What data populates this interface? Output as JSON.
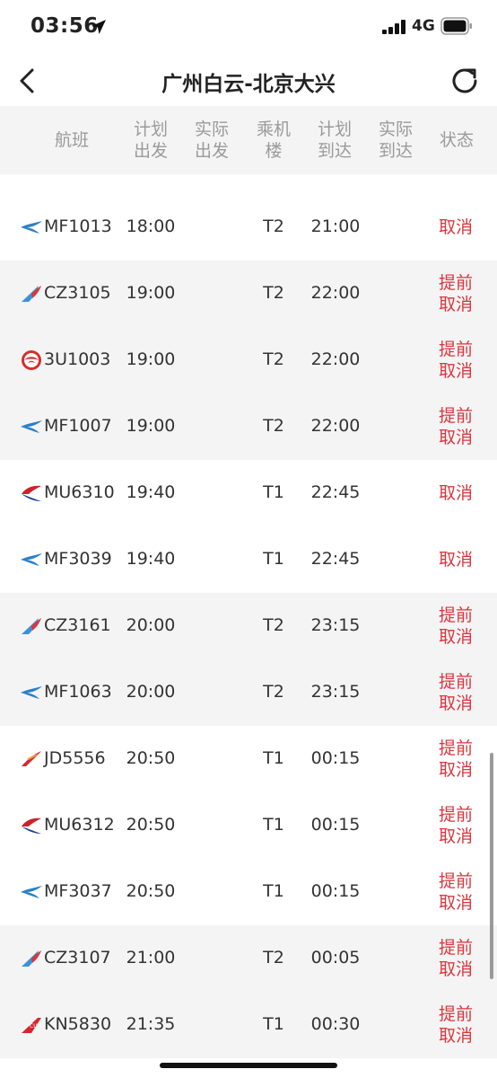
{
  "status_bar": {
    "time": "03:56",
    "network": "4G"
  },
  "nav": {
    "title": "广州白云-北京大兴"
  },
  "columns": {
    "flight": "航班",
    "planned_dep": [
      "计划",
      "出发"
    ],
    "actual_dep": [
      "实际",
      "出发"
    ],
    "terminal": [
      "乘机",
      "楼"
    ],
    "planned_arr": [
      "计划",
      "到达"
    ],
    "actual_arr": [
      "实际",
      "到达"
    ],
    "status": "状态"
  },
  "colors": {
    "status_red": "#d9363e",
    "header_gray": "#9a9a9a",
    "stripe_gray": "#f4f4f4"
  },
  "flights": [
    {
      "logo": "xiamen-airlines-logo",
      "flight": "MF1013",
      "dep": "18:00",
      "terminal": "T2",
      "arr": "21:00",
      "status": [
        "取消"
      ]
    },
    {
      "logo": "china-southern-logo",
      "flight": "CZ3105",
      "dep": "19:00",
      "terminal": "T2",
      "arr": "22:00",
      "status": [
        "提前",
        "取消"
      ]
    },
    {
      "logo": "sichuan-airlines-logo",
      "flight": "3U1003",
      "dep": "19:00",
      "terminal": "T2",
      "arr": "22:00",
      "status": [
        "提前",
        "取消"
      ]
    },
    {
      "logo": "xiamen-airlines-logo",
      "flight": "MF1007",
      "dep": "19:00",
      "terminal": "T2",
      "arr": "22:00",
      "status": [
        "提前",
        "取消"
      ]
    },
    {
      "logo": "china-eastern-logo",
      "flight": "MU6310",
      "dep": "19:40",
      "terminal": "T1",
      "arr": "22:45",
      "status": [
        "取消"
      ]
    },
    {
      "logo": "xiamen-airlines-logo",
      "flight": "MF3039",
      "dep": "19:40",
      "terminal": "T1",
      "arr": "22:45",
      "status": [
        "取消"
      ]
    },
    {
      "logo": "china-southern-logo",
      "flight": "CZ3161",
      "dep": "20:00",
      "terminal": "T2",
      "arr": "23:15",
      "status": [
        "提前",
        "取消"
      ]
    },
    {
      "logo": "xiamen-airlines-logo",
      "flight": "MF1063",
      "dep": "20:00",
      "terminal": "T2",
      "arr": "23:15",
      "status": [
        "提前",
        "取消"
      ]
    },
    {
      "logo": "capital-airlines-logo",
      "flight": "JD5556",
      "dep": "20:50",
      "terminal": "T1",
      "arr": "00:15",
      "status": [
        "提前",
        "取消"
      ]
    },
    {
      "logo": "china-eastern-logo",
      "flight": "MU6312",
      "dep": "20:50",
      "terminal": "T1",
      "arr": "00:15",
      "status": [
        "提前",
        "取消"
      ]
    },
    {
      "logo": "xiamen-airlines-logo",
      "flight": "MF3037",
      "dep": "20:50",
      "terminal": "T1",
      "arr": "00:15",
      "status": [
        "提前",
        "取消"
      ]
    },
    {
      "logo": "china-southern-logo",
      "flight": "CZ3107",
      "dep": "21:00",
      "terminal": "T2",
      "arr": "00:05",
      "status": [
        "提前",
        "取消"
      ]
    },
    {
      "logo": "china-united-logo",
      "flight": "KN5830",
      "dep": "21:35",
      "terminal": "T1",
      "arr": "00:30",
      "status": [
        "提前",
        "取消"
      ]
    }
  ]
}
